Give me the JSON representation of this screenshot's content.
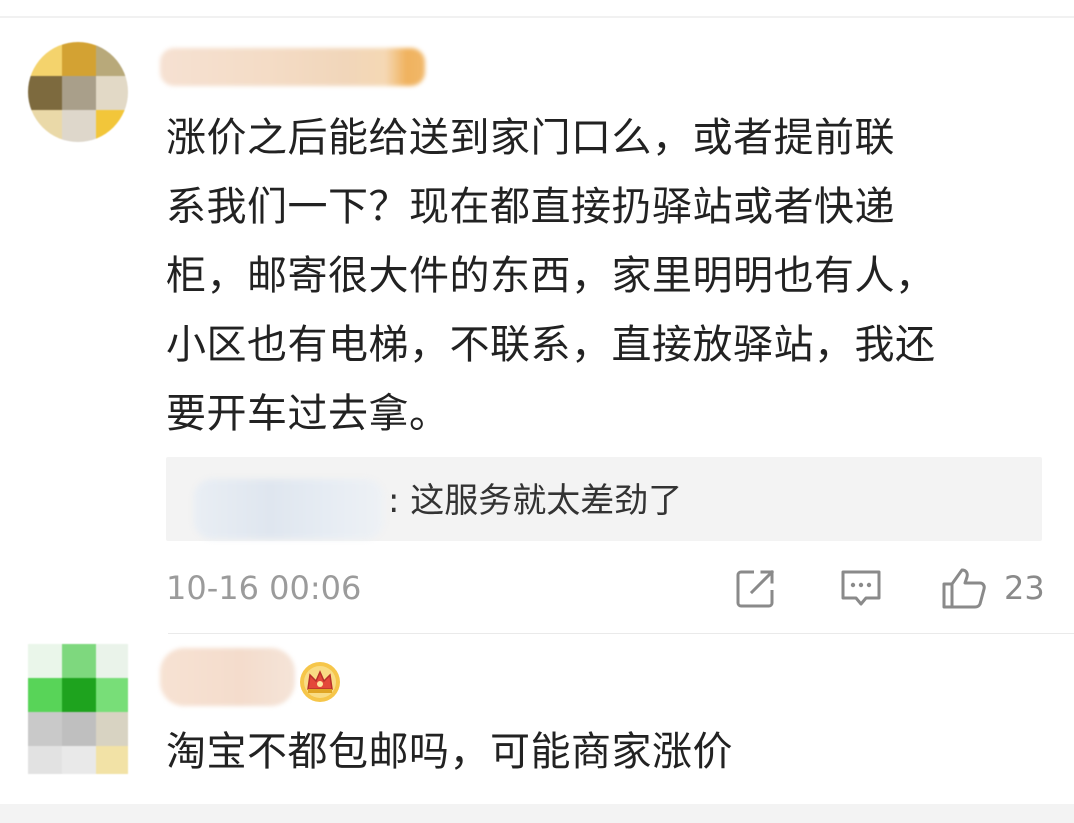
{
  "comments": [
    {
      "text_lines": [
        "涨价之后能给送到家门口么，或者提前联",
        "系我们一下？现在都直接扔驿站或者快递",
        "柜，邮寄很大件的东西，家里明明也有人，",
        "小区也有电梯，不联系，直接放驿站，我还",
        "要开车过去拿。"
      ],
      "reply": {
        "text": ": 这服务就太差劲了"
      },
      "timestamp": "10-16 00:06",
      "likes": "23",
      "actions": {
        "share_icon": "share-icon",
        "comment_icon": "comment-icon",
        "like_icon": "thumbs-up-icon"
      }
    },
    {
      "text": "淘宝不都包邮吗，可能商家涨价",
      "badge_icon": "crown-icon"
    }
  ],
  "colors": {
    "text": "#222222",
    "meta": "#9b9b9b",
    "reply_bg": "#f3f3f3",
    "icon": "#8a8a8a"
  }
}
